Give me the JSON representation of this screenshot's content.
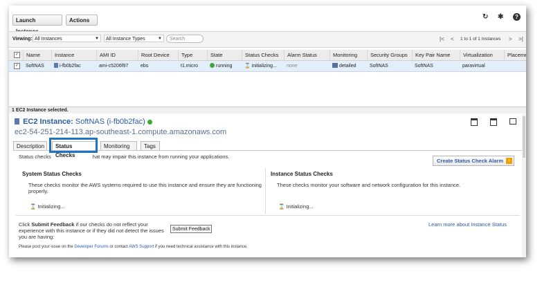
{
  "toolbar": {
    "launch_label": "Launch Instance",
    "actions_label": "Actions",
    "actions_arrow": "⌄",
    "refresh_glyph": "↻",
    "gear_glyph": "✱",
    "help_glyph": "?"
  },
  "filters": {
    "viewing_label": "Viewing:",
    "instances_value": "All Instances",
    "types_value": "All Instance Types",
    "search_placeholder": "Search",
    "pager_text": "1 to 1 of 1 Instances"
  },
  "table": {
    "headers": [
      "Name",
      "Instance",
      "AMI ID",
      "Root Device",
      "Type",
      "State",
      "Status Checks",
      "Alarm Status",
      "Monitoring",
      "Security Groups",
      "Key Pair Name",
      "Virtualization",
      "Placeme"
    ],
    "row": {
      "name": "SoftNAS",
      "instance": "i-fb0b2fac",
      "ami": "ami-c5206f97",
      "root_device": "ebs",
      "type": "t1.micro",
      "state": "running",
      "status_checks": "initializing...",
      "alarm_status": "none",
      "monitoring": "detailed",
      "security_groups": "SoftNAS",
      "key_pair": "SoftNAS",
      "virtualization": "paravirtual"
    }
  },
  "selection_text": "1 EC2 Instance selected.",
  "detail": {
    "title_prefix": "EC2 Instance:",
    "title_value": "SoftNAS (i-fb0b2fac)",
    "dns": "ec2-54-251-214-113.ap-southeast-1.compute.amazonaws.com",
    "tabs": [
      "Description",
      "Status Checks",
      "Monitoring",
      "Tags"
    ],
    "intro_a": "Status checks",
    "intro_b": "hat may impair this instance from running your applications.",
    "create_alarm_label": "Create Status Check Alarm",
    "system_heading": "System Status Checks",
    "system_text": "These checks monitor the AWS systems required to use this instance and ensure they are functioning properly.",
    "system_status": "Initializing...",
    "instance_heading": "Instance Status Checks",
    "instance_text": "These checks monitor your software and network configuration for this instance.",
    "instance_status": "Initializing...",
    "feedback_click": "Click",
    "feedback_bold": "Submit Feedback",
    "feedback_rest": "if our checks do not reflect your experience with this instance or if they did not detect the issues you are having:",
    "submit_label": "Submit Feedback",
    "learn_more": "Learn more about Instance Status",
    "post_a": "Please post your issue on the",
    "dev_forums": "Developer Forums",
    "post_b": "or contact",
    "aws_support": "AWS Support",
    "post_c": "if you need technical assistance with this instance."
  },
  "colors": {
    "accent": "#1e73c4",
    "link": "#2a5aa8",
    "running": "#3ca935",
    "selected_row": "#e3eef9"
  }
}
